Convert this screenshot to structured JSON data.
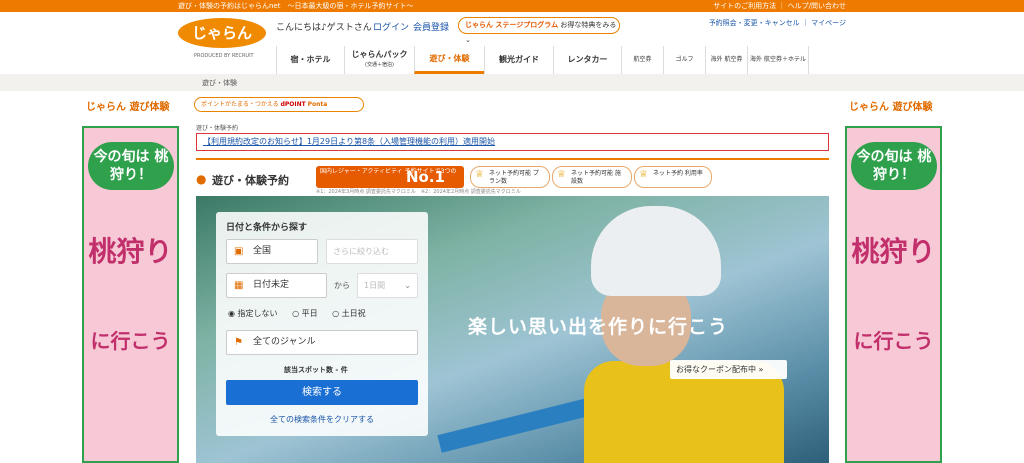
{
  "topbar": {
    "left": "遊び・体験の予約はじゃらんnet　〜日本最大級の宿・ホテル予約サイト〜",
    "right": "サイトのご利用方法 ｜ ヘルプ/問い合わせ"
  },
  "header": {
    "logo": "じゃらん",
    "produced_by": "PRODUCED BY RECRUIT",
    "greeting": "こんにちは♪ゲストさん",
    "login": "ログイン",
    "register": "会員登録",
    "stage_tag": "じゃらん ステージプログラム",
    "stage_text": "お得な特典をみる ⌄",
    "links": "予約照会・変更・キャンセル ｜ マイページ"
  },
  "nav": [
    {
      "label": "宿・ホテル",
      "sub": ""
    },
    {
      "label": "じゃらんパック",
      "sub": "(交通＋宿泊)"
    },
    {
      "label": "遊び・体験",
      "sub": ""
    },
    {
      "label": "観光ガイド",
      "sub": ""
    },
    {
      "label": "レンタカー",
      "sub": ""
    },
    {
      "label": "航空券",
      "sub": ""
    },
    {
      "label": "ゴルフ",
      "sub": ""
    },
    {
      "label": "海外 航空券",
      "sub": ""
    },
    {
      "label": "海外 航空券＋ホテル",
      "sub": ""
    }
  ],
  "breadcrumb": "遊び・体験",
  "side": {
    "brand": "じゃらん 遊び体験",
    "head": "今の旬は 桃狩り！",
    "big": "桃狩り",
    "mid": "に行こう"
  },
  "points": {
    "text": "ポイントがたまる・つかえる",
    "dpoint": "dPOINT",
    "ponta": "Ponta"
  },
  "crumb2": "遊び・体験予約",
  "notice": "【利用規約改定のお知らせ】1月29日より第8条（入場管理機能の利用）適用開始",
  "page": {
    "heading": "遊び・体験予約",
    "no1_text": "国内レジャー・アクティビティ 予約サイトで3つの",
    "no1_big": "No.1",
    "award1": "ネット予約可能 プラン数",
    "award2": "ネット予約可能 施設数",
    "award3": "ネット予約 利用率",
    "footnote": "※1：2024年3月時点 調査委託先マクロミル　※2：2024年2月時点 調査委託先マクロミル"
  },
  "hero": {
    "catch": "楽しい思い出を作りに行こう",
    "coupon": "お得なクーポン配布中 »"
  },
  "search": {
    "title": "日付と条件から探す",
    "area": "全国",
    "area_ph": "さらに絞り込む",
    "date": "日付未定",
    "kara": "から",
    "days": "1日間",
    "radios": [
      "指定しない",
      "平日",
      "土日祝"
    ],
    "genre": "全てのジャンル",
    "count": "該当スポット数 - 件",
    "button": "検索する",
    "clear": "全ての検索条件をクリアする"
  }
}
